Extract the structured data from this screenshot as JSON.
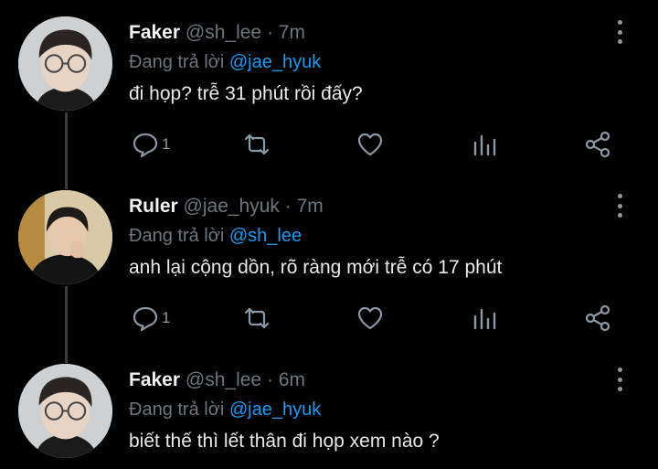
{
  "tweets": [
    {
      "name": "Faker",
      "handle": "@sh_lee",
      "dot": "·",
      "time": "7m",
      "reply_prefix": "Đang trả lời",
      "reply_handle": "@jae_hyuk",
      "text": "đi họp? trễ 31 phút rồi đấy?",
      "reply_count": "1",
      "avatar_icon": "person-photo"
    },
    {
      "name": "Ruler",
      "handle": "@jae_hyuk",
      "dot": "·",
      "time": "7m",
      "reply_prefix": "Đang trả lời",
      "reply_handle": "@sh_lee",
      "text": "anh lại cộng dồn, rõ ràng mới trễ có 17 phút",
      "reply_count": "1",
      "avatar_icon": "person-photo"
    },
    {
      "name": "Faker",
      "handle": "@sh_lee",
      "dot": "·",
      "time": "6m",
      "reply_prefix": "Đang trả lời",
      "reply_handle": "@jae_hyuk",
      "text": "biết thế thì lết thân đi họp xem nào ?",
      "avatar_icon": "person-photo"
    }
  ],
  "colors": {
    "background": "#000000",
    "text": "#e7e9ea",
    "muted": "#6e767d",
    "accent": "#1d9bf0",
    "icon": "#8b98a5",
    "thread_line": "#3a3d40"
  },
  "icons": [
    "reply-icon",
    "retweet-icon",
    "like-icon",
    "analytics-icon",
    "share-icon",
    "more-icon"
  ]
}
